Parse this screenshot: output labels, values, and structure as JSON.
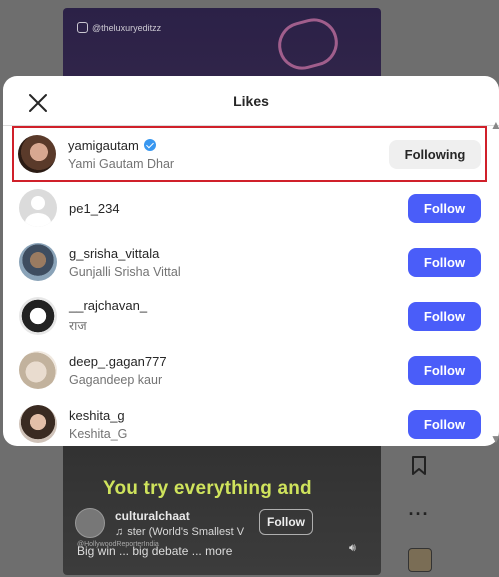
{
  "reel": {
    "watermark": "@theluxuryeditzz",
    "caption_overlay": "You try everything and",
    "author": "culturalchaat",
    "audio": "ster (World's Smallest V",
    "follow_label": "Follow",
    "caption": "Big win ... big debate ... more",
    "small_watermark": "@HollywoodReporterIndia"
  },
  "modal": {
    "title": "Likes",
    "users": [
      {
        "username": "yamigautam",
        "fullname": "Yami Gautam Dhar",
        "verified": true,
        "button": "Following"
      },
      {
        "username": "pe1_234",
        "fullname": "",
        "verified": false,
        "button": "Follow"
      },
      {
        "username": "g_srisha_vittala",
        "fullname": "Gunjalli Srisha Vittal",
        "verified": false,
        "button": "Follow"
      },
      {
        "username": "__rajchavan_",
        "fullname": "राज",
        "verified": false,
        "button": "Follow"
      },
      {
        "username": "deep_.gagan777",
        "fullname": "Gagandeep kaur",
        "verified": false,
        "button": "Follow"
      },
      {
        "username": "keshita_g",
        "fullname": "Keshita_G",
        "verified": false,
        "button": "Follow"
      }
    ]
  },
  "colors": {
    "follow_blue": "#4a5df9",
    "highlight_red": "#d0202a",
    "verified_blue": "#3897f0"
  }
}
